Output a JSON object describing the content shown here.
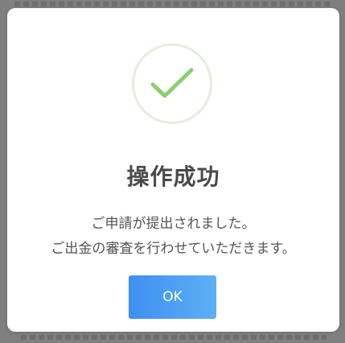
{
  "dialog": {
    "title": "操作成功",
    "message_line1": "ご申請が提出されました。",
    "message_line2": "ご出金の審査を行わせていただきます。",
    "ok_label": "OK",
    "icon": "checkmark-icon"
  },
  "colors": {
    "check_stroke": "#8bcf6e",
    "circle_ring": "#e4eedd",
    "button_start": "#3f8ef2",
    "button_end": "#5cb0f5",
    "title_text": "#4a4a4a"
  }
}
